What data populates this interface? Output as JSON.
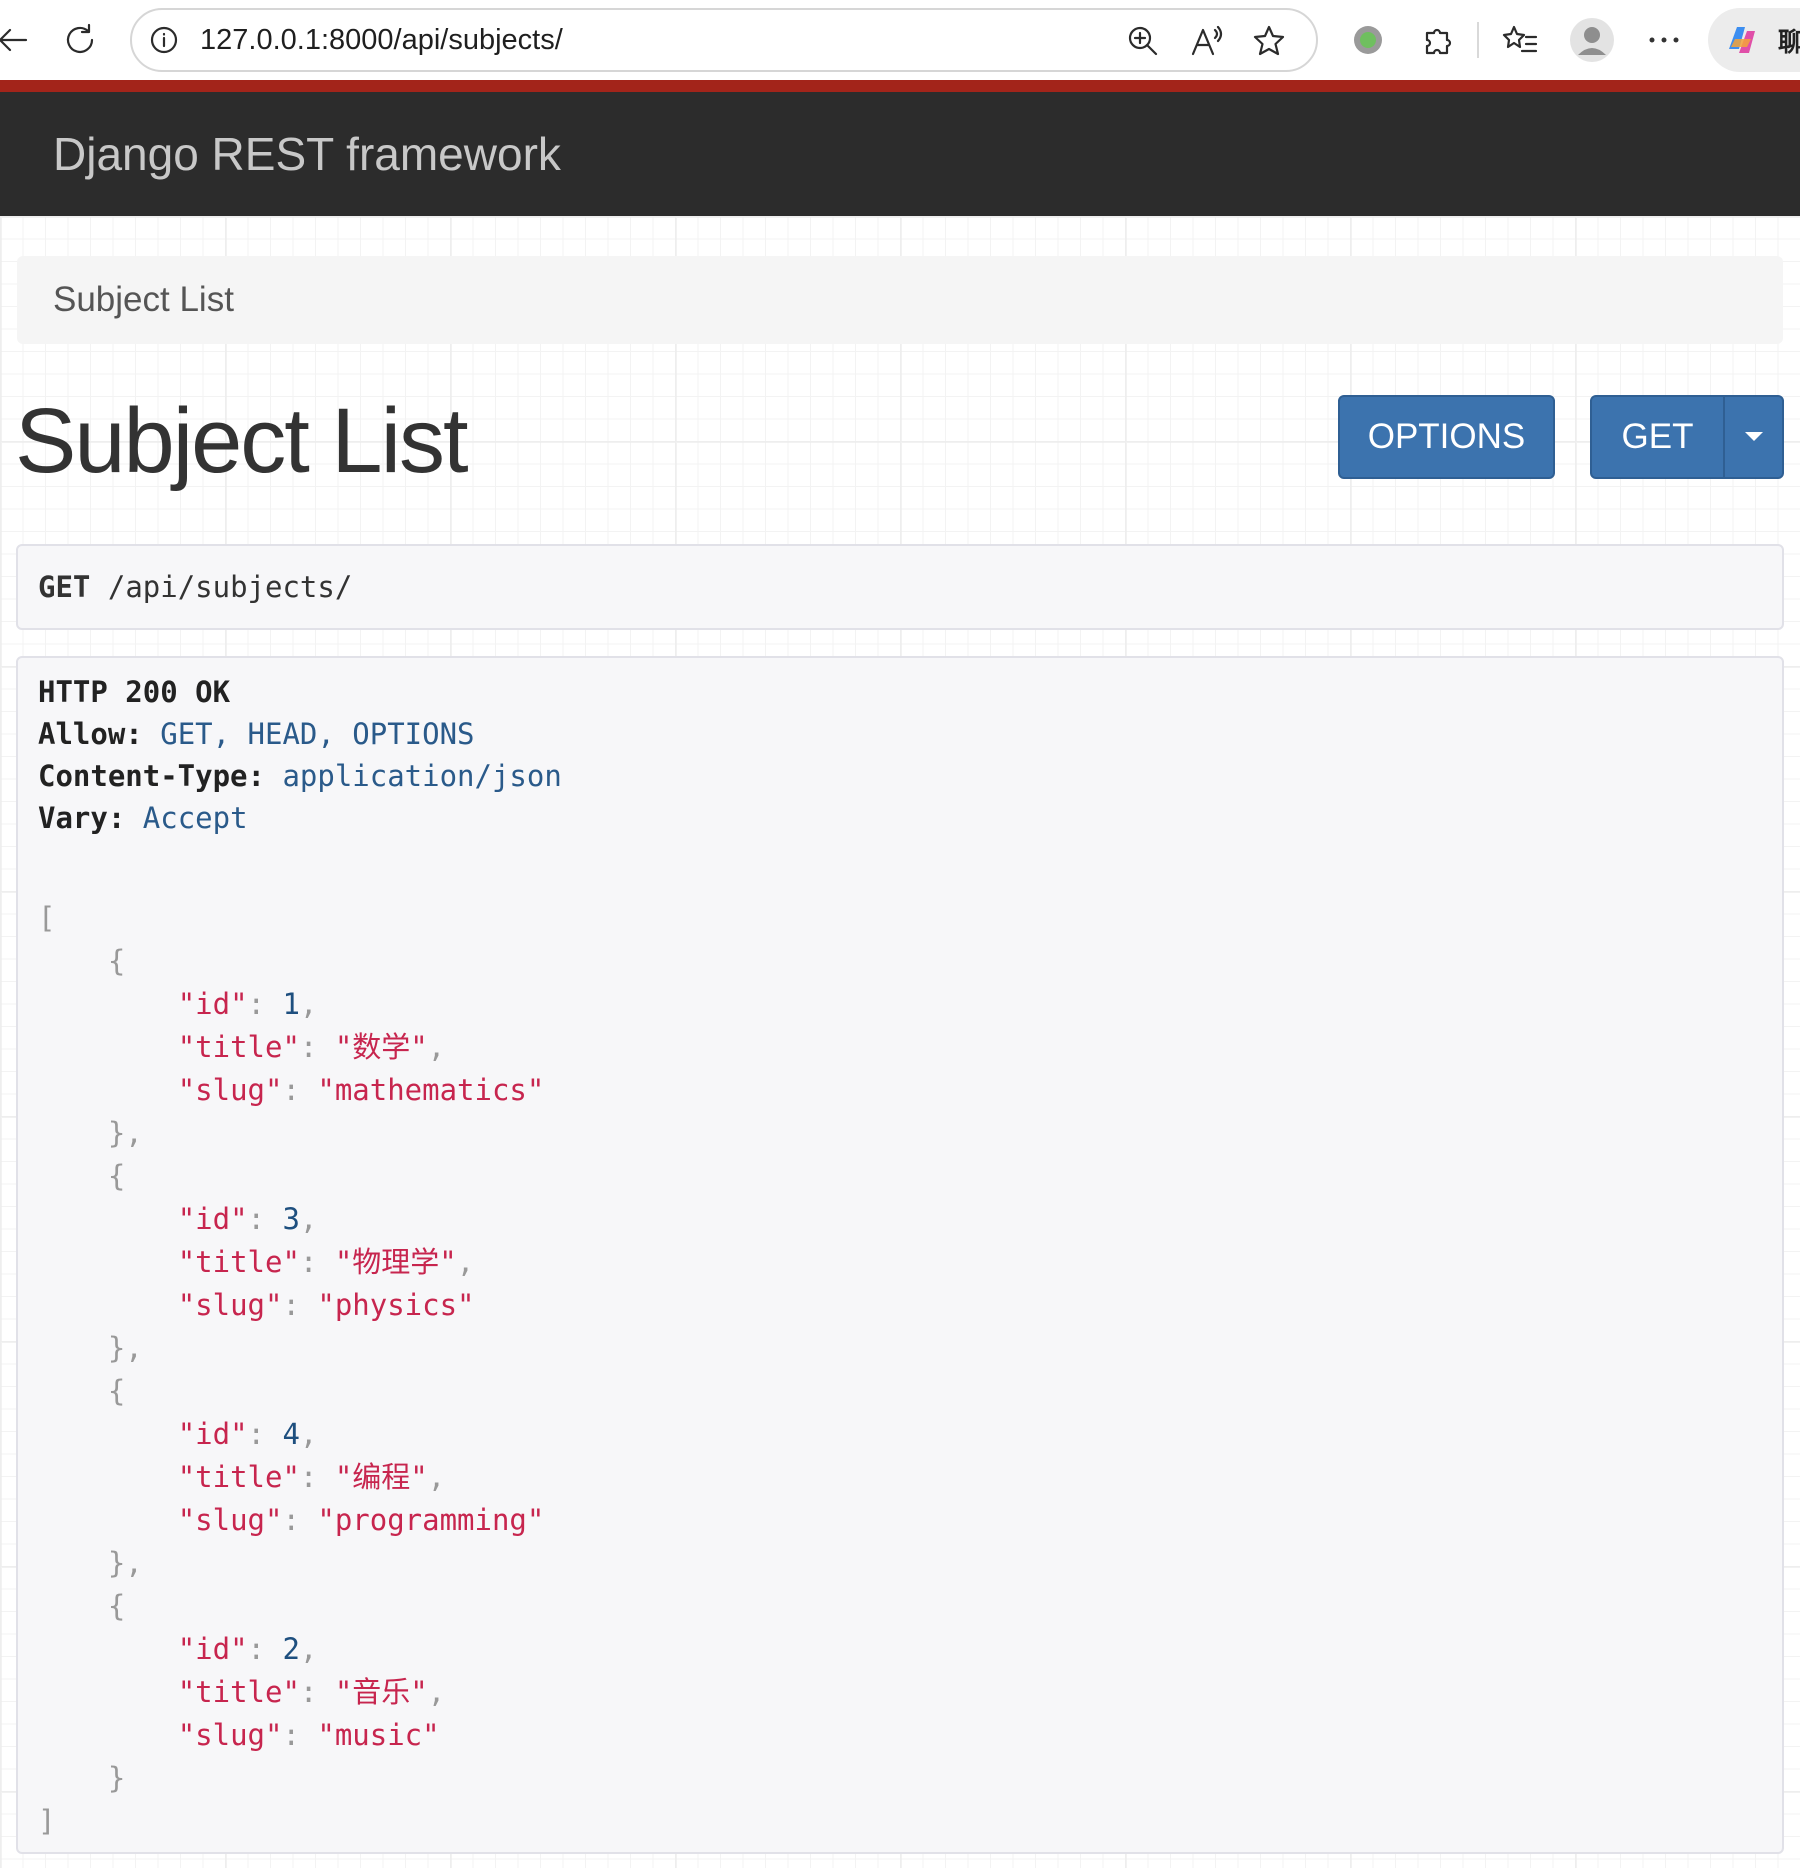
{
  "browser": {
    "url": "127.0.0.1:8000/api/subjects/",
    "copilot_label": "聊"
  },
  "navbar": {
    "brand": "Django REST framework"
  },
  "breadcrumb": {
    "current": "Subject List"
  },
  "page": {
    "title": "Subject List",
    "options_label": "OPTIONS",
    "get_label": "GET"
  },
  "request": {
    "method": "GET",
    "path": "/api/subjects/"
  },
  "response": {
    "status": "HTTP 200 OK",
    "headers": [
      {
        "name": "Allow:",
        "value": "GET, HEAD, OPTIONS"
      },
      {
        "name": "Content-Type:",
        "value": "application/json"
      },
      {
        "name": "Vary:",
        "value": "Accept"
      }
    ],
    "body": [
      {
        "id": "1",
        "title": "\"数学\"",
        "slug": "\"mathematics\""
      },
      {
        "id": "3",
        "title": "\"物理学\"",
        "slug": "\"physics\""
      },
      {
        "id": "4",
        "title": "\"编程\"",
        "slug": "\"programming\""
      },
      {
        "id": "2",
        "title": "\"音乐\"",
        "slug": "\"music\""
      }
    ]
  },
  "colors": {
    "navbar_bg": "#2c2c2c",
    "accent_strip": "#a3241a",
    "button_bg": "#3c73ae",
    "json_string": "#c7254e",
    "json_number": "#1e4f7f"
  }
}
